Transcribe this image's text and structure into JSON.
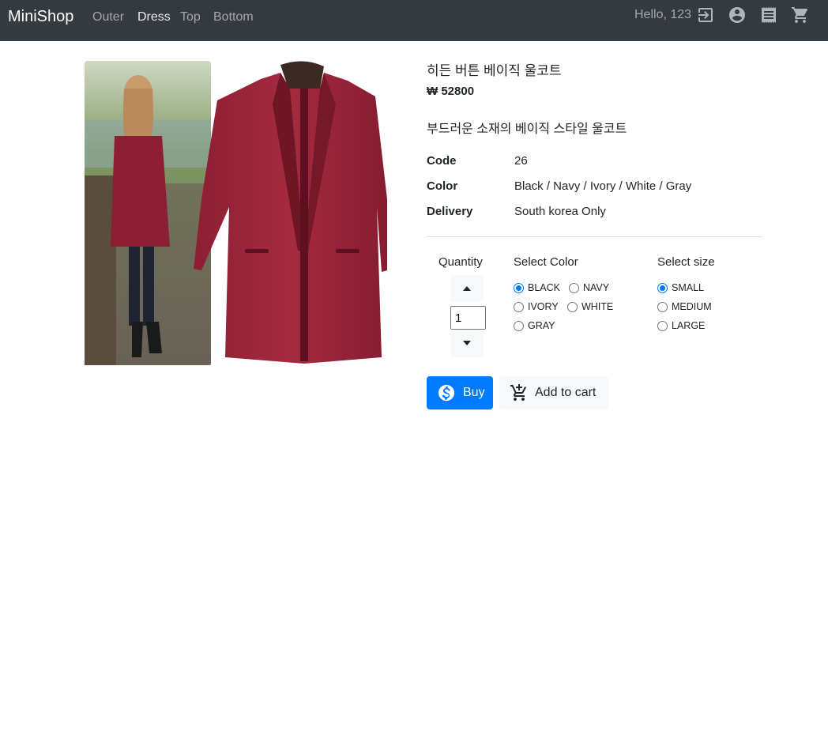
{
  "nav": {
    "brand": "MiniShop",
    "links": [
      "Outer",
      "Dress",
      "Top",
      "Bottom"
    ],
    "active_link": "Dress",
    "greeting": "Hello, 123",
    "icons": [
      "logout-icon",
      "account-circle-icon",
      "receipt-icon",
      "cart-icon"
    ]
  },
  "product": {
    "image_alt": "burgundy wool coat",
    "title": "히든 버튼 베이직 울코트",
    "price": "₩ 52800",
    "description": "부드러운 소재의 베이직 스타일 울코트",
    "info": [
      {
        "key": "Code",
        "value": "26"
      },
      {
        "key": "Color",
        "value": "Black / Navy / Ivory / White / Gray"
      },
      {
        "key": "Delivery",
        "value": "South korea Only"
      }
    ]
  },
  "options": {
    "quantity_label": "Quantity",
    "quantity_value": "1",
    "color_label": "Select Color",
    "colors": [
      "BLACK",
      "NAVY",
      "IVORY",
      "WHITE",
      "GRAY"
    ],
    "selected_color": "BLACK",
    "size_label": "Select size",
    "sizes": [
      "SMALL",
      "MEDIUM",
      "LARGE"
    ],
    "selected_size": "SMALL"
  },
  "actions": {
    "buy_label": "Buy",
    "cart_label": "Add to cart"
  },
  "colors": {
    "navbar": "#343a40",
    "primary": "#007bff",
    "coat": "#9b2335"
  }
}
